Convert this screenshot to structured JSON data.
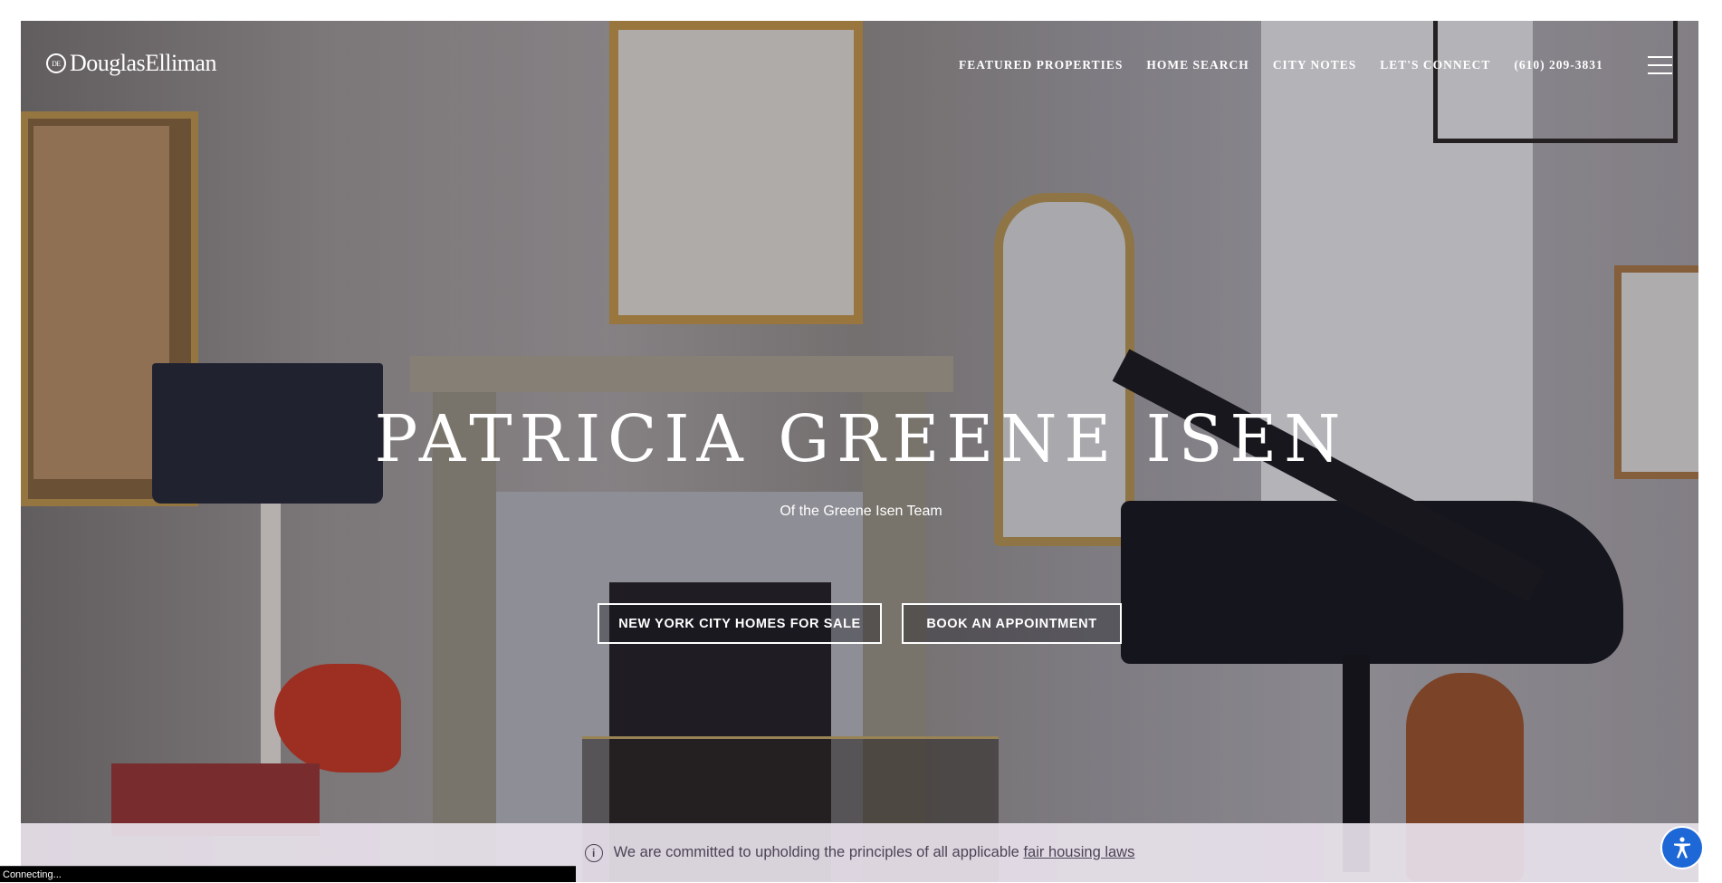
{
  "brand": {
    "logo_text": "DouglasElliman",
    "logo_mark": "DE"
  },
  "nav": {
    "items": [
      {
        "label": "FEATURED PROPERTIES"
      },
      {
        "label": "HOME SEARCH"
      },
      {
        "label": "CITY NOTES"
      },
      {
        "label": "LET'S CONNECT"
      },
      {
        "label": "(610) 209-3831"
      }
    ],
    "menu_icon": "hamburger-menu-icon"
  },
  "hero": {
    "title": "PATRICIA GREENE ISEN",
    "subtitle": "Of the Greene Isen Team",
    "buttons": [
      {
        "label": "NEW YORK CITY HOMES FOR SALE"
      },
      {
        "label": "BOOK AN APPOINTMENT"
      }
    ]
  },
  "notice": {
    "icon": "info-icon",
    "text": "We are committed to upholding the principles of all applicable",
    "link_text": "fair housing laws"
  },
  "status_bar": {
    "text": "Connecting..."
  },
  "accessibility": {
    "icon": "accessibility-icon"
  },
  "colors": {
    "overlay_text": "#ffffff",
    "notice_bg": "#e8e2eb",
    "notice_text": "#4c4456",
    "accessibility_button": "#1d67d6"
  }
}
